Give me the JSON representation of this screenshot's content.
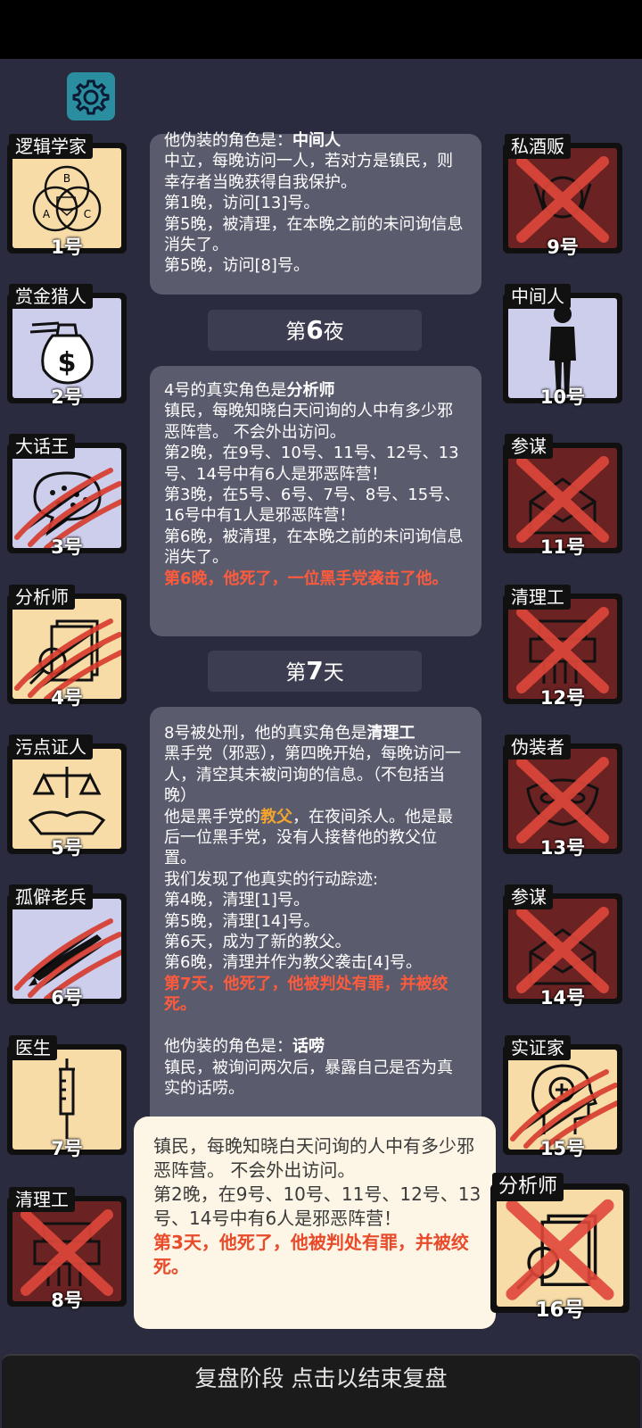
{
  "settings": {
    "icon": "gear-icon"
  },
  "players": [
    {
      "role": "逻辑学家",
      "num": "1号",
      "team": "town",
      "dead": false,
      "scratched": false,
      "icon": "venn-diagram-icon",
      "venn": [
        "B",
        "A",
        "C"
      ]
    },
    {
      "role": "赏金猎人",
      "num": "2号",
      "team": "neutral",
      "dead": false,
      "scratched": false,
      "icon": "money-bag-icon"
    },
    {
      "role": "大话王",
      "num": "3号",
      "team": "neutral",
      "dead": false,
      "scratched": true,
      "icon": "speech-bubble-icon"
    },
    {
      "role": "分析师",
      "num": "4号",
      "team": "town",
      "dead": false,
      "scratched": true,
      "icon": "magnifier-documents-icon"
    },
    {
      "role": "污点证人",
      "num": "5号",
      "team": "town",
      "dead": false,
      "scratched": false,
      "icon": "scales-handshake-icon"
    },
    {
      "role": "孤僻老兵",
      "num": "6号",
      "team": "neutral",
      "dead": false,
      "scratched": true,
      "icon": "rifle-icon"
    },
    {
      "role": "医生",
      "num": "7号",
      "team": "town",
      "dead": false,
      "scratched": false,
      "icon": "syringe-icon"
    },
    {
      "role": "清理工",
      "num": "8号",
      "team": "evil",
      "dead": true,
      "scratched": false,
      "icon": "shredder-icon"
    },
    {
      "role": "私酒贩",
      "num": "9号",
      "team": "evil",
      "dead": true,
      "scratched": false,
      "icon": "bottles-icon"
    },
    {
      "role": "中间人",
      "num": "10号",
      "team": "neutral",
      "dead": false,
      "scratched": false,
      "icon": "standing-man-icon"
    },
    {
      "role": "参谋",
      "num": "11号",
      "team": "evil",
      "dead": true,
      "scratched": false,
      "icon": "envelope-icon"
    },
    {
      "role": "清理工",
      "num": "12号",
      "team": "evil",
      "dead": true,
      "scratched": false,
      "icon": "shredder-icon"
    },
    {
      "role": "伪装者",
      "num": "13号",
      "team": "evil",
      "dead": true,
      "scratched": false,
      "icon": "mask-icon"
    },
    {
      "role": "参谋",
      "num": "14号",
      "team": "evil",
      "dead": true,
      "scratched": false,
      "icon": "envelope-icon"
    },
    {
      "role": "实证家",
      "num": "15号",
      "team": "town",
      "dead": false,
      "scratched": true,
      "icon": "head-plus-icon"
    },
    {
      "role": "分析师",
      "num": "16号",
      "team": "town",
      "dead": true,
      "scratched": false,
      "icon": "magnifier-documents-icon"
    }
  ],
  "log": {
    "block1": {
      "cut_line": "他伪装的角色是：",
      "cut_line_role": "中间人",
      "lines": [
        "中立，每晚访问一人，若对方是镇民，则幸存者当晚获得自我保护。",
        "第1晚，访问[13]号。",
        "第5晚，被清理，在本晚之前的未问询信息消失了。",
        "第5晚，访问[8]号。"
      ]
    },
    "night6": {
      "prefix": "第",
      "num": "6",
      "suffix": "夜"
    },
    "block2": {
      "intro": "4号的真实角色是",
      "role": "分析师",
      "lines": [
        "镇民，每晚知晓白天问询的人中有多少邪恶阵营。 不会外出访问。",
        "第2晚，在9号、10号、11号、12号、13号、14号中有6人是邪恶阵营！",
        "第3晚，在5号、6号、7号、8号、15号、16号中有1人是邪恶阵营！",
        "第6晚，被清理，在本晚之前的未问询信息消失了。"
      ],
      "death": "第6晚，他死了，一位黑手党袭击了他。"
    },
    "day7": {
      "prefix": "第",
      "num": "7",
      "suffix": "天"
    },
    "block3": {
      "intro": "8号被处刑，他的真实角色是",
      "role": "清理工",
      "lines_a": [
        "黑手党（邪恶），第四晚开始，每晚访问一人，清空其未被问询的信息。（不包括当晚）"
      ],
      "godfather_pre": "他是黑手党的",
      "godfather": "教父",
      "godfather_post": "，在夜间杀人。他是最后一位黑手党，没有人接替他的教父位置。",
      "lines_b": [
        "我们发现了他真实的行动踪迹:",
        "第4晚，清理[1]号。",
        "第5晚，清理[14]号。",
        "第6天，成为了新的教父。",
        "第6晚，清理并作为教父袭击[4]号。"
      ],
      "death": "第7天，他死了，他被判处有罪，并被绞死。",
      "disguise_pre": "他伪装的角色是：",
      "disguise": "话唠",
      "disguise_line": "镇民，被询问两次后，暴露自己是否为真实的话唠。"
    }
  },
  "popup": {
    "lines": [
      "镇民，每晚知晓白天问询的人中有多少邪恶阵营。 不会外出访问。",
      "第2晚，在9号、10号、11号、12号、13号、14号中有6人是邪恶阵营！"
    ],
    "death": "第3天，他死了，他被判处有罪，并被绞死。"
  },
  "footer": {
    "label": "复盘阶段 点击以结束复盘"
  }
}
